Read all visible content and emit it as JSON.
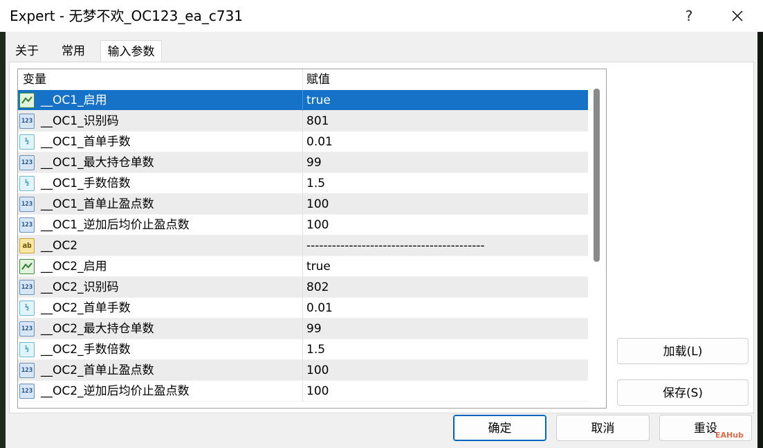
{
  "window": {
    "title": "Expert - 无梦不欢_OC123_ea_c731",
    "help": "?"
  },
  "tabs": [
    {
      "label": "关于"
    },
    {
      "label": "常用"
    },
    {
      "label": "输入参数"
    }
  ],
  "grid": {
    "headers": {
      "variable": "变量",
      "value": "赋值"
    },
    "rows": [
      {
        "type": "bool",
        "icon_text": "",
        "name": "__OC1_启用",
        "value": "true"
      },
      {
        "type": "int",
        "icon_text": "123",
        "name": "__OC1_识别码",
        "value": "801"
      },
      {
        "type": "double",
        "icon_text": "½",
        "name": "__OC1_首单手数",
        "value": "0.01"
      },
      {
        "type": "int",
        "icon_text": "123",
        "name": "__OC1_最大持仓单数",
        "value": "99"
      },
      {
        "type": "double",
        "icon_text": "½",
        "name": "__OC1_手数倍数",
        "value": "1.5"
      },
      {
        "type": "int",
        "icon_text": "123",
        "name": "__OC1_首单止盈点数",
        "value": "100"
      },
      {
        "type": "int",
        "icon_text": "123",
        "name": "__OC1_逆加后均价止盈点数",
        "value": "100"
      },
      {
        "type": "string",
        "icon_text": "ab",
        "name": "__OC2",
        "value": "------------------------------------------"
      },
      {
        "type": "bool",
        "icon_text": "",
        "name": "__OC2_启用",
        "value": "true"
      },
      {
        "type": "int",
        "icon_text": "123",
        "name": "__OC2_识别码",
        "value": "802"
      },
      {
        "type": "double",
        "icon_text": "½",
        "name": "__OC2_首单手数",
        "value": "0.01"
      },
      {
        "type": "int",
        "icon_text": "123",
        "name": "__OC2_最大持仓单数",
        "value": "99"
      },
      {
        "type": "double",
        "icon_text": "½",
        "name": "__OC2_手数倍数",
        "value": "1.5"
      },
      {
        "type": "int",
        "icon_text": "123",
        "name": "__OC2_首单止盈点数",
        "value": "100"
      },
      {
        "type": "int",
        "icon_text": "123",
        "name": "__OC2_逆加后均价止盈点数",
        "value": "100"
      }
    ]
  },
  "side_buttons": {
    "load": "加载(L)",
    "save": "保存(S)"
  },
  "footer_buttons": {
    "ok": "确定",
    "cancel": "取消",
    "reset": "重设"
  },
  "watermark": {
    "text": "EAHub"
  }
}
